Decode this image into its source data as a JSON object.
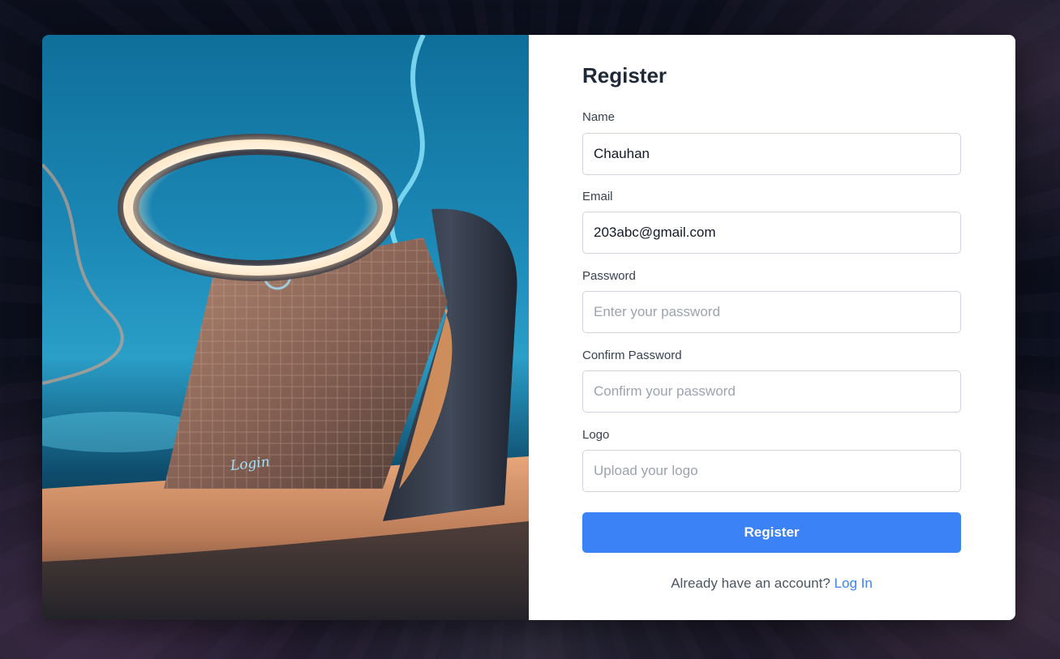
{
  "hero": {
    "image_alt": "futuristic device illustration",
    "device_text": "Login"
  },
  "form": {
    "title": "Register",
    "fields": [
      {
        "label": "Name",
        "value": "Chauhan",
        "placeholder": ""
      },
      {
        "label": "Email",
        "value": "203abc@gmail.com",
        "placeholder": ""
      },
      {
        "label": "Password",
        "value": "",
        "placeholder": "Enter your password"
      },
      {
        "label": "Confirm Password",
        "value": "",
        "placeholder": "Confirm your password"
      },
      {
        "label": "Logo",
        "value": "",
        "placeholder": "Upload your logo"
      }
    ],
    "submit_label": "Register",
    "footer_text": "Already have an account?",
    "footer_link": "Log In"
  },
  "colors": {
    "accent": "#3b82f6",
    "card_bg": "#ffffff",
    "title": "#1f2937"
  }
}
